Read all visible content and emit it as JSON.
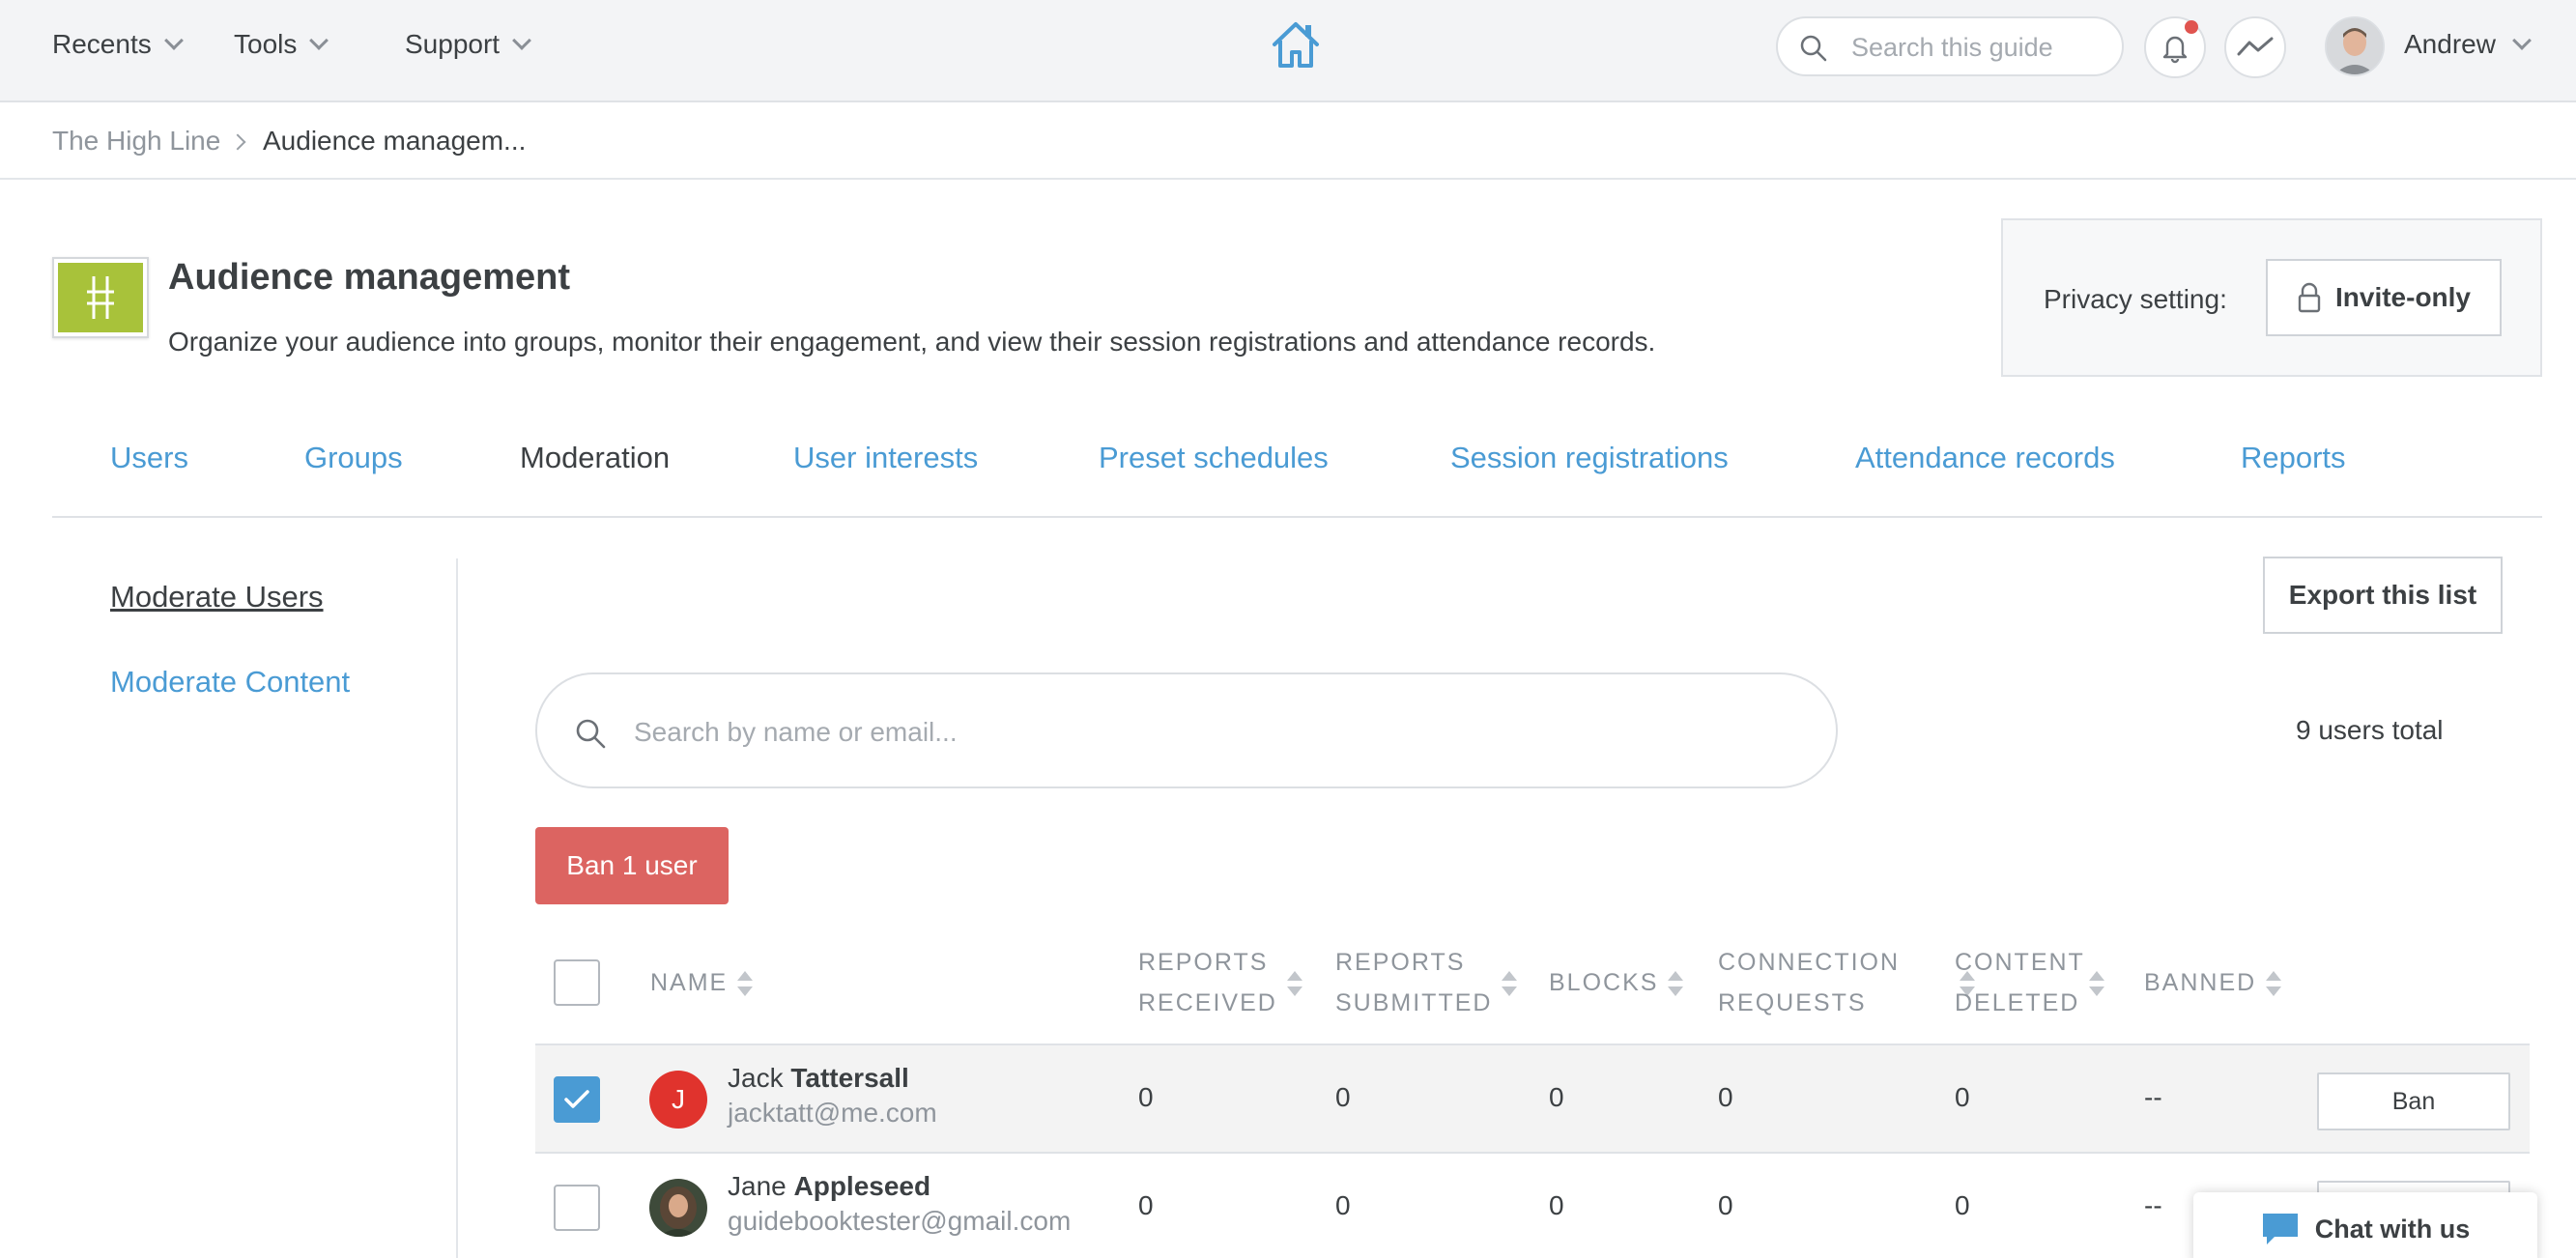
{
  "topbar": {
    "menus": [
      {
        "label": "Recents"
      },
      {
        "label": "Tools"
      },
      {
        "label": "Support"
      }
    ],
    "search_placeholder": "Search this guide",
    "user_name": "Andrew",
    "notification_dot_color": "#e0544f"
  },
  "breadcrumb": {
    "parent": "The High Line",
    "current": "Audience managem..."
  },
  "header": {
    "title": "Audience management",
    "description": "Organize your audience into groups, monitor their engagement, and view their session registrations and attendance records.",
    "logo_color": "#a8c23a",
    "privacy_label": "Privacy setting:",
    "privacy_value": "Invite-only"
  },
  "tabs": [
    {
      "label": "Users"
    },
    {
      "label": "Groups"
    },
    {
      "label": "Moderation",
      "active": true
    },
    {
      "label": "User interests"
    },
    {
      "label": "Preset schedules"
    },
    {
      "label": "Session registrations"
    },
    {
      "label": "Attendance records"
    },
    {
      "label": "Reports"
    }
  ],
  "sidebar": {
    "items": [
      {
        "label": "Moderate Users",
        "active": true
      },
      {
        "label": "Moderate Content"
      }
    ]
  },
  "main": {
    "export_label": "Export this list",
    "search_placeholder": "Search by name or email...",
    "users_total": "9 users total",
    "ban_selected_label": "Ban 1 user"
  },
  "table": {
    "headers": {
      "name": "NAME",
      "reports_received_1": "REPORTS",
      "reports_received_2": "RECEIVED",
      "reports_submitted_1": "REPORTS",
      "reports_submitted_2": "SUBMITTED",
      "blocks": "BLOCKS",
      "connection_requests_1": "CONNECTION",
      "connection_requests_2": "REQUESTS",
      "content_deleted_1": "CONTENT",
      "content_deleted_2": "DELETED",
      "banned": "BANNED"
    },
    "rows": [
      {
        "first_name": "Jack",
        "last_name": "Tattersall",
        "email": "jacktatt@me.com",
        "avatar_initial": "J",
        "avatar_color": "#e0332d",
        "selected": true,
        "reports_received": "0",
        "reports_submitted": "0",
        "blocks": "0",
        "connection_requests": "0",
        "content_deleted": "0",
        "banned": "--",
        "action": "Ban"
      },
      {
        "first_name": "Jane",
        "last_name": "Appleseed",
        "email": "guidebooktester@gmail.com",
        "avatar_initial": "",
        "avatar_color": "#5a4636",
        "selected": false,
        "reports_received": "0",
        "reports_submitted": "0",
        "blocks": "0",
        "connection_requests": "0",
        "content_deleted": "0",
        "banned": "--",
        "action": "Ban"
      }
    ]
  },
  "chat": {
    "label": "Chat with us"
  },
  "colors": {
    "link_blue": "#4a9bd4",
    "danger_red": "#dc6461",
    "check_blue": "#4a9bd4"
  }
}
